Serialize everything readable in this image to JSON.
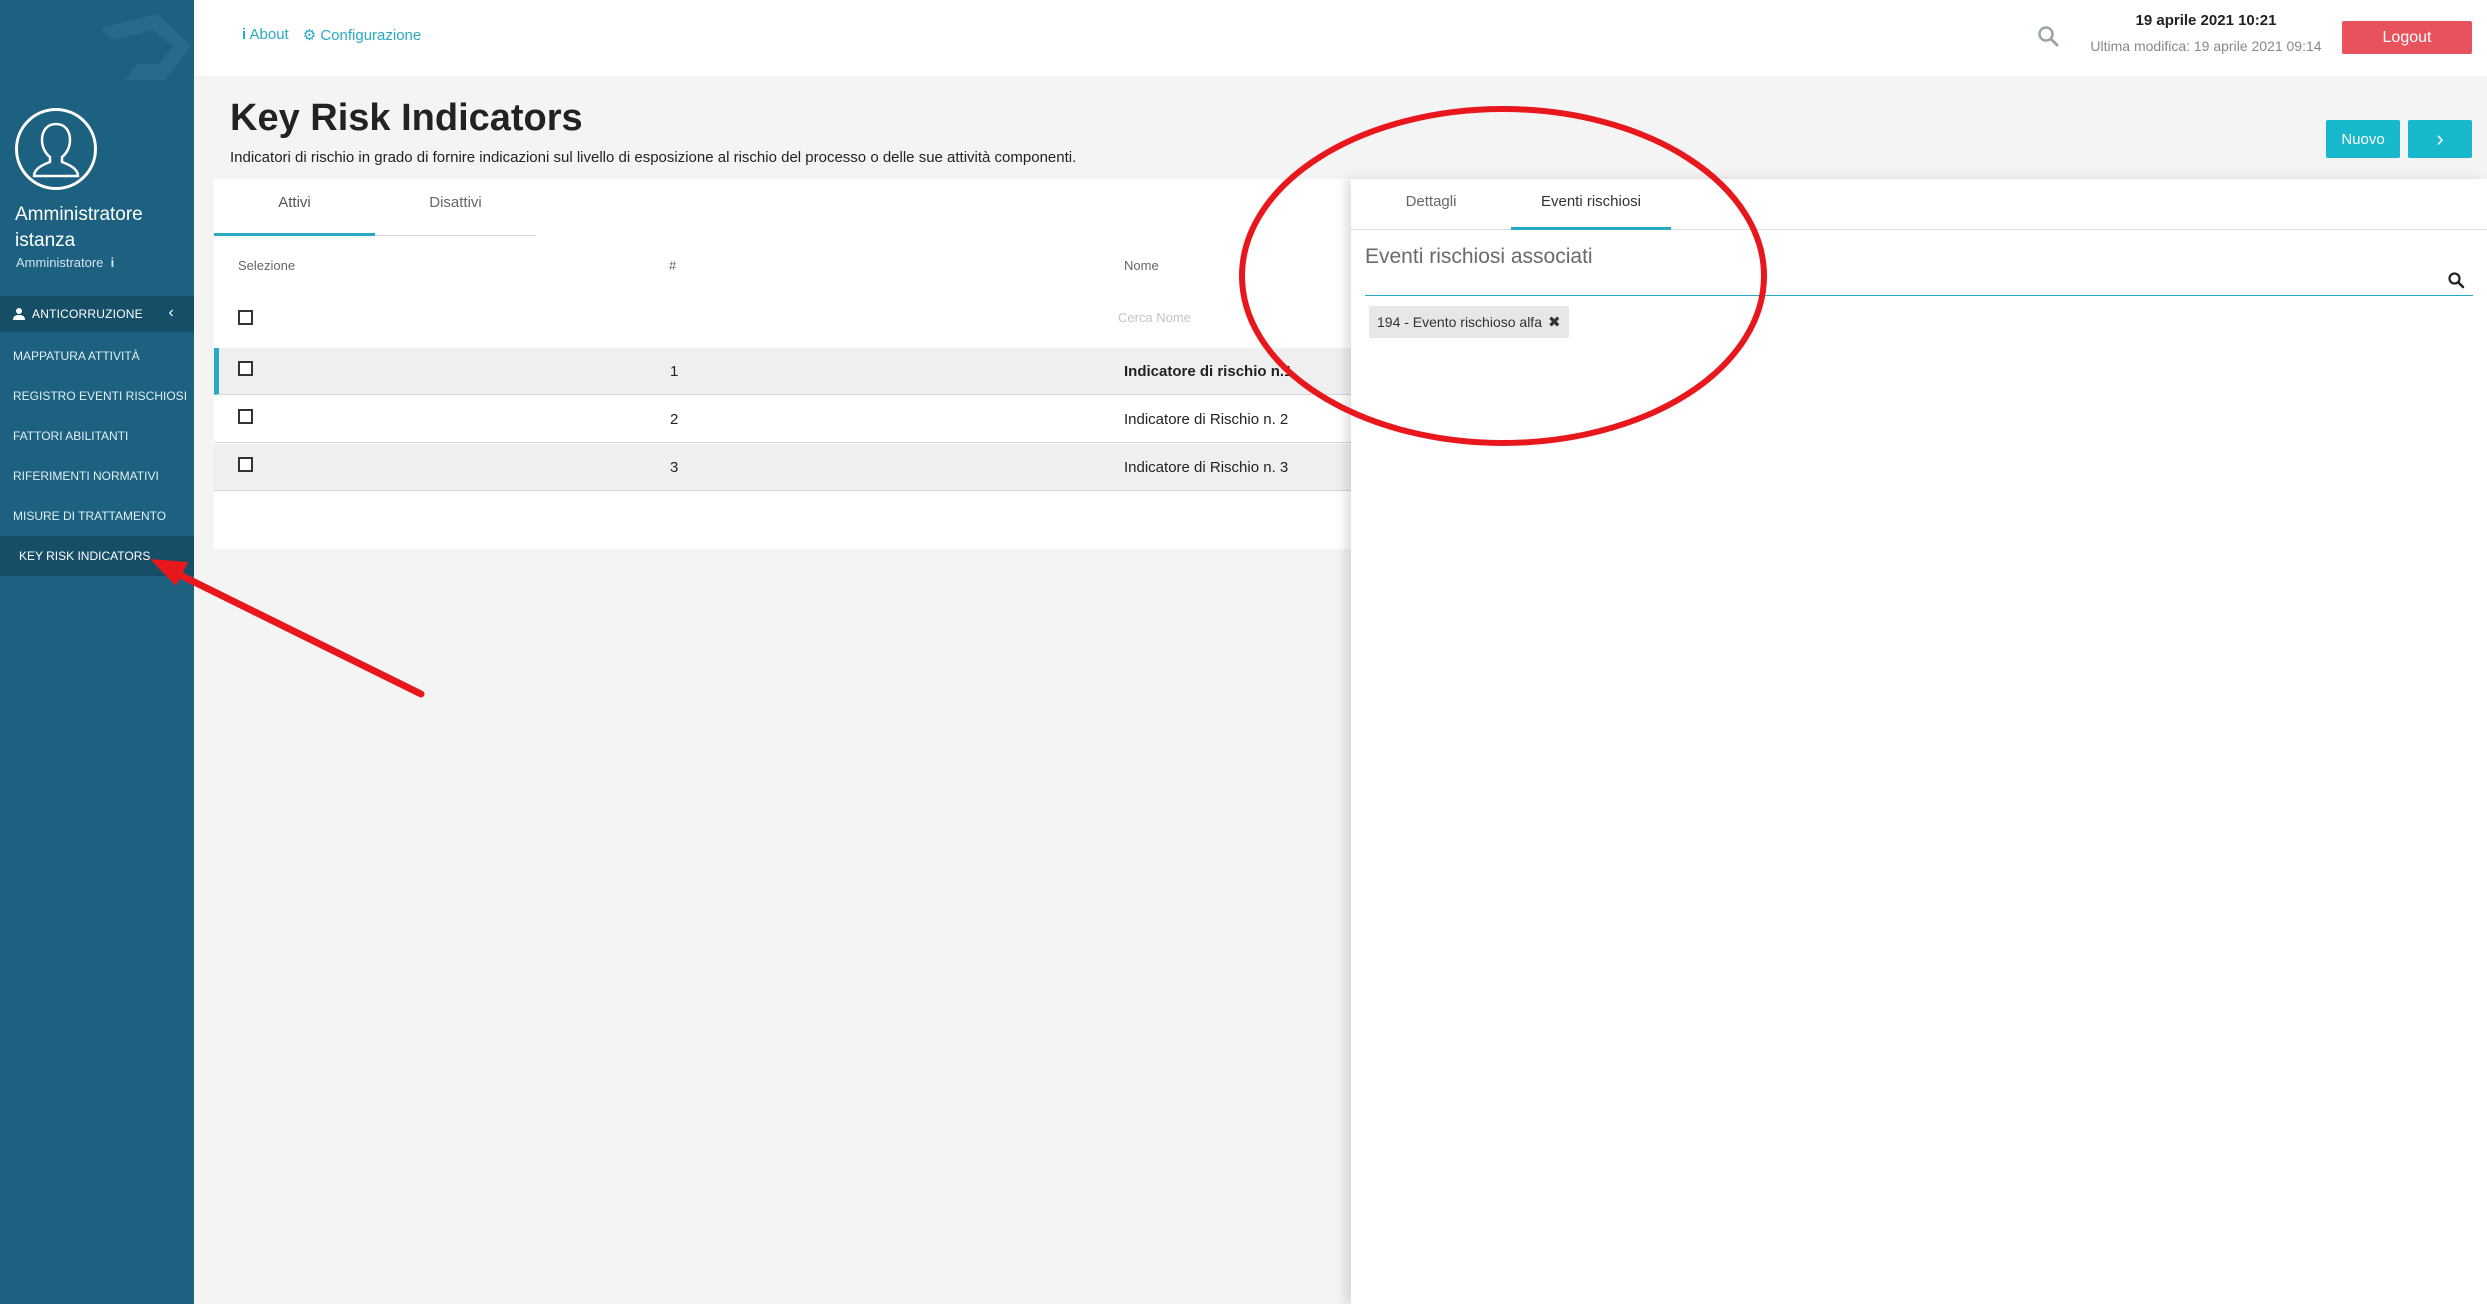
{
  "user": {
    "name": "Amministratore istanza",
    "role": "Amministratore"
  },
  "sidebar": {
    "section_label": "ANTICORRUZIONE",
    "items": [
      {
        "label": "MAPPATURA ATTIVITÀ"
      },
      {
        "label": "REGISTRO EVENTI RISCHIOSI"
      },
      {
        "label": "FATTORI ABILITANTI"
      },
      {
        "label": "RIFERIMENTI NORMATIVI"
      },
      {
        "label": "MISURE DI TRATTAMENTO"
      },
      {
        "label": "KEY RISK INDICATORS"
      }
    ]
  },
  "header": {
    "about_label": "About",
    "config_label": "Configurazione",
    "datetime": "19 aprile 2021 10:21",
    "last_modified": "Ultima modifica: 19 aprile 2021 09:14",
    "logout_label": "Logout"
  },
  "page": {
    "title": "Key Risk Indicators",
    "description": "Indicatori di rischio in grado di fornire indicazioni sul livello di esposizione al rischio del processo o delle sue attività componenti.",
    "new_label": "Nuovo",
    "next_label": "›"
  },
  "list": {
    "tabs": [
      {
        "label": "Attivi"
      },
      {
        "label": "Disattivi"
      }
    ],
    "columns": {
      "selection": "Selezione",
      "number": "#",
      "name": "Nome"
    },
    "filter_placeholder": "Cerca Nome",
    "rows": [
      {
        "num": "1",
        "name": "Indicatore di rischio n.1"
      },
      {
        "num": "2",
        "name": "Indicatore di Rischio n. 2"
      },
      {
        "num": "3",
        "name": "Indicatore di Rischio n. 3"
      }
    ]
  },
  "detail": {
    "tabs": [
      {
        "label": "Dettagli"
      },
      {
        "label": "Eventi rischiosi"
      }
    ],
    "section_title": "Eventi rischiosi associati",
    "tags": [
      {
        "label": "194 - Evento rischioso alfa"
      }
    ]
  },
  "colors": {
    "sidebar": "#1c617f",
    "accent": "#2aa9c4",
    "button": "#17b8cc",
    "logout": "#e8525d",
    "annotation": "#e8171c"
  }
}
